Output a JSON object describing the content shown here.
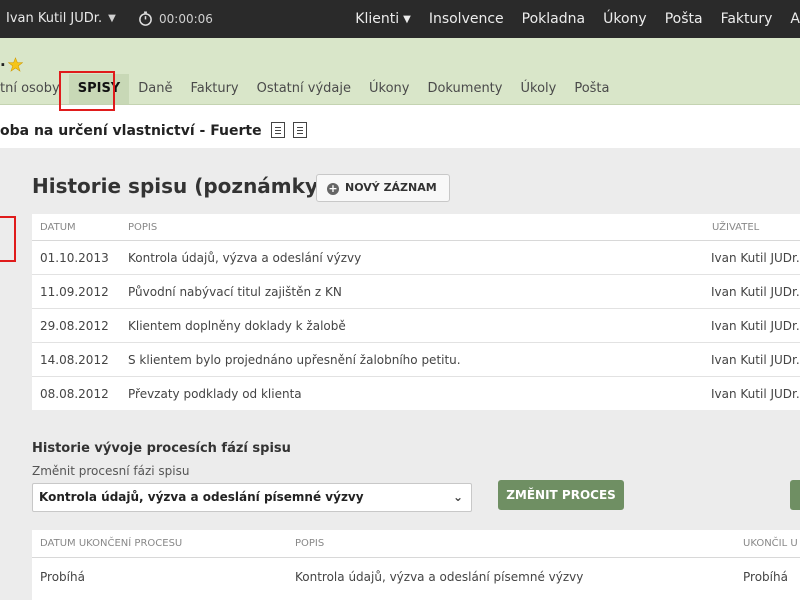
{
  "topbar": {
    "user": "Ivan Kutil JUDr.",
    "timer": "00:00:06",
    "nav": [
      "Klienti",
      "Insolvence",
      "Pokladna",
      "Úkony",
      "Pošta",
      "Faktury",
      "A"
    ]
  },
  "header": {
    "title_fragment": ".",
    "tabs": [
      "tní osoby",
      "SPISY",
      "Daně",
      "Faktury",
      "Ostatní výdaje",
      "Úkony",
      "Dokumenty",
      "Úkoly",
      "Pošta"
    ],
    "active_tab": "SPISY"
  },
  "case": {
    "title": "oba na určení vlastnictví - Fuerte"
  },
  "history": {
    "heading": "Historie spisu (poznámky)",
    "new_button": "NOVÝ ZÁZNAM",
    "columns": {
      "date": "DATUM",
      "desc": "POPIS",
      "user": "UŽIVATEL"
    },
    "rows": [
      {
        "date": "01.10.2013",
        "desc": "Kontrola údajů, výzva a odeslání výzvy",
        "user": "Ivan Kutil JUDr."
      },
      {
        "date": "11.09.2012",
        "desc": "Původní nabývací titul zajištěn z KN",
        "user": "Ivan Kutil JUDr."
      },
      {
        "date": "29.08.2012",
        "desc": "Klientem doplněny doklady k žalobě",
        "user": "Ivan Kutil JUDr."
      },
      {
        "date": "14.08.2012",
        "desc": "S klientem bylo projednáno upřesnění žalobního petitu.",
        "user": "Ivan Kutil JUDr."
      },
      {
        "date": "08.08.2012",
        "desc": "Převzaty podklady od klienta",
        "user": "Ivan Kutil JUDr."
      }
    ]
  },
  "process": {
    "heading": "Historie vývoje procesích fází spisu",
    "change_label": "Změnit procesní fázi spisu",
    "selected": "Kontrola údajů, výzva a odeslání písemné výzvy",
    "change_button": "ZMĚNIT PROCES",
    "columns": {
      "end_date": "DATUM UKONČENÍ PROCESU",
      "desc": "POPIS",
      "ended_by": "UKONČIL U"
    },
    "rows": [
      {
        "end_date": "Probíhá",
        "desc": "Kontrola údajů, výzva a odeslání písemné výzvy",
        "ended_by": "Probíhá"
      }
    ]
  },
  "colors": {
    "topbar": "#2a2a2a",
    "header": "#d9e6c9",
    "accent_green": "#6f8f63",
    "highlight_red": "#e01b1b"
  }
}
